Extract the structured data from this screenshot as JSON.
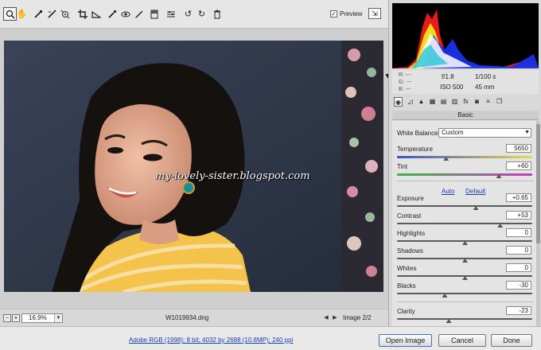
{
  "toolbar": {
    "tools": [
      "zoom-icon",
      "hand-icon",
      "white-balance-icon",
      "color-sampler-icon",
      "targeted-adjustment-icon",
      "crop-icon",
      "straighten-icon",
      "spot-removal-icon",
      "red-eye-icon",
      "adjustment-brush-icon",
      "graduated-filter-icon",
      "preferences-icon",
      "rotate-ccw-icon",
      "rotate-cw-icon",
      "trash-icon"
    ],
    "preview_label": "Preview",
    "preview_checked": true
  },
  "photo": {
    "watermark": "my-lovely-sister.blogspot.com"
  },
  "image_status": {
    "zoom": "16.9%",
    "filename": "W1019934.dng",
    "image_count": "Image 2/2"
  },
  "dialog": {
    "workflow_link": "Adobe RGB (1998); 8 bit; 4032 by 2688 (10.8MP); 240 ppi",
    "open_image": "Open Image",
    "cancel": "Cancel",
    "done": "Done"
  },
  "camera_info": {
    "r": "R:",
    "g": "G:",
    "b": "B:",
    "r_val": "---",
    "g_val": "---",
    "b_val": "---",
    "aperture": "f/1.8",
    "shutter": "1/100 s",
    "iso": "ISO 500",
    "focal": "45 mm"
  },
  "panel": {
    "title": "Basic",
    "white_balance_label": "White Balance:",
    "white_balance_value": "Custom",
    "auto": "Auto",
    "default": "Default",
    "sliders": [
      {
        "label": "Temperature",
        "value": "5650",
        "pos": 0.36
      },
      {
        "label": "Tint",
        "value": "+60",
        "pos": 0.75
      },
      {
        "label": "Exposure",
        "value": "+0.65",
        "pos": 0.58
      },
      {
        "label": "Contrast",
        "value": "+53",
        "pos": 0.76
      },
      {
        "label": "Highlights",
        "value": "0",
        "pos": 0.5
      },
      {
        "label": "Shadows",
        "value": "0",
        "pos": 0.5
      },
      {
        "label": "Whites",
        "value": "0",
        "pos": 0.5
      },
      {
        "label": "Blacks",
        "value": "-30",
        "pos": 0.35
      },
      {
        "label": "Clarity",
        "value": "-23",
        "pos": 0.38
      }
    ]
  },
  "colors": {
    "accent_link": "#1a3fb5",
    "temperature_gradient": [
      "#3b53c8",
      "#e8d84a"
    ],
    "tint_gradient": [
      "#3fb543",
      "#c23cc4"
    ]
  }
}
